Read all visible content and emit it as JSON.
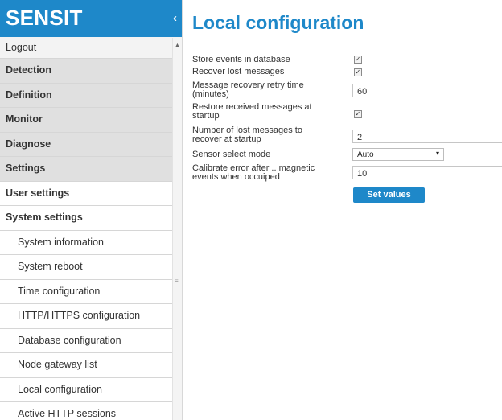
{
  "brand": {
    "name": "SENSIT",
    "collapse_icon": "‹"
  },
  "sidebar": {
    "items": [
      {
        "label": "Logout",
        "kind": "first"
      },
      {
        "label": "Detection",
        "kind": "top"
      },
      {
        "label": "Definition",
        "kind": "top"
      },
      {
        "label": "Monitor",
        "kind": "top"
      },
      {
        "label": "Diagnose",
        "kind": "top"
      },
      {
        "label": "Settings",
        "kind": "top"
      },
      {
        "label": "User settings",
        "kind": "section"
      },
      {
        "label": "System settings",
        "kind": "section"
      },
      {
        "label": "System information",
        "kind": "sub"
      },
      {
        "label": "System reboot",
        "kind": "sub"
      },
      {
        "label": "Time configuration",
        "kind": "sub"
      },
      {
        "label": "HTTP/HTTPS configuration",
        "kind": "sub"
      },
      {
        "label": "Database configuration",
        "kind": "sub"
      },
      {
        "label": "Node gateway list",
        "kind": "sub"
      },
      {
        "label": "Local configuration",
        "kind": "sub"
      },
      {
        "label": "Active HTTP sessions",
        "kind": "sub"
      }
    ],
    "scroll_up_icon": "▲",
    "scroll_grip_icon": "≡"
  },
  "main": {
    "title": "Local configuration",
    "fields": {
      "store_events": {
        "label": "Store events in database",
        "checked": true
      },
      "recover_lost": {
        "label": "Recover lost messages",
        "checked": true
      },
      "retry_time": {
        "label": "Message recovery retry time (minutes)",
        "value": "60"
      },
      "restore_received": {
        "label": "Restore received messages at startup",
        "checked": true
      },
      "lost_count": {
        "label": "Number of lost messages to recover at startup",
        "value": "2"
      },
      "sensor_mode": {
        "label": "Sensor select mode",
        "value": "Auto",
        "caret": "▾"
      },
      "calibrate": {
        "label": "Calibrate error after .. magnetic events when occuiped",
        "value": "10"
      }
    },
    "check_mark": "✓",
    "set_values_label": "Set values"
  },
  "colors": {
    "accent": "#1e88c9",
    "menu_gray": "#e0e0e0",
    "text": "#333333"
  }
}
